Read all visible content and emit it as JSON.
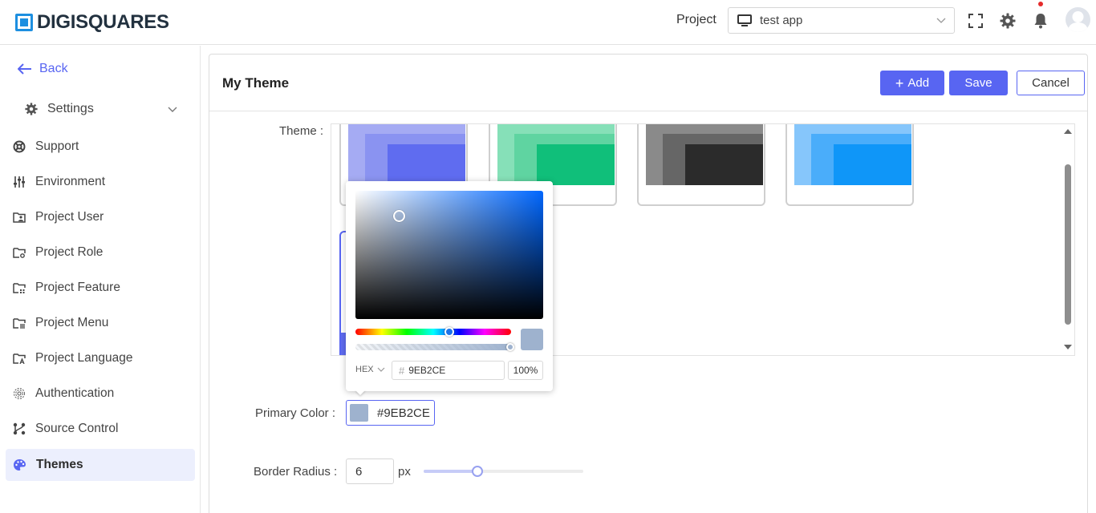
{
  "header": {
    "logo_text": "DIGISQUARES",
    "project_label": "Project",
    "project_value": "test app"
  },
  "sidebar": {
    "back_label": "Back",
    "settings_label": "Settings",
    "items": [
      {
        "label": "Support",
        "icon": "lifebuoy-icon"
      },
      {
        "label": "Environment",
        "icon": "sliders-icon"
      },
      {
        "label": "Project User",
        "icon": "folder-user-icon"
      },
      {
        "label": "Project Role",
        "icon": "folder-role-icon"
      },
      {
        "label": "Project Feature",
        "icon": "folder-feature-icon"
      },
      {
        "label": "Project Menu",
        "icon": "folder-menu-icon"
      },
      {
        "label": "Project Language",
        "icon": "folder-language-icon"
      },
      {
        "label": "Authentication",
        "icon": "fingerprint-icon"
      },
      {
        "label": "Source Control",
        "icon": "git-icon"
      },
      {
        "label": "Themes",
        "icon": "palette-icon",
        "active": true
      }
    ]
  },
  "main": {
    "title": "My Theme",
    "add_label": "Add",
    "save_label": "Save",
    "cancel_label": "Cancel",
    "theme_label": "Theme :",
    "theme_cards": [
      {
        "colors": [
          "#a5abf3",
          "#8a93f1",
          "#5f6cf0"
        ]
      },
      {
        "colors": [
          "#86e0b8",
          "#5fd4a1",
          "#10bf7a"
        ]
      },
      {
        "colors": [
          "#8a8a8a",
          "#666666",
          "#2b2b2b"
        ]
      },
      {
        "colors": [
          "#86c6fb",
          "#4aadfa",
          "#0f96f8"
        ]
      }
    ],
    "primary_color_label": "Primary Color :",
    "primary_color_value": "#9EB2CE",
    "border_radius_label": "Border Radius :",
    "border_radius_value": "6",
    "border_radius_unit": "px",
    "border_radius_slider_fraction": 0.33
  },
  "picker": {
    "mode": "HEX",
    "hex_value": "9EB2CE",
    "alpha_value": "100%",
    "hue_color": "#0067ff",
    "selected_color": "#9eb2ce"
  },
  "colors": {
    "accent": "#5865f2",
    "active_bg": "#eceffd"
  }
}
